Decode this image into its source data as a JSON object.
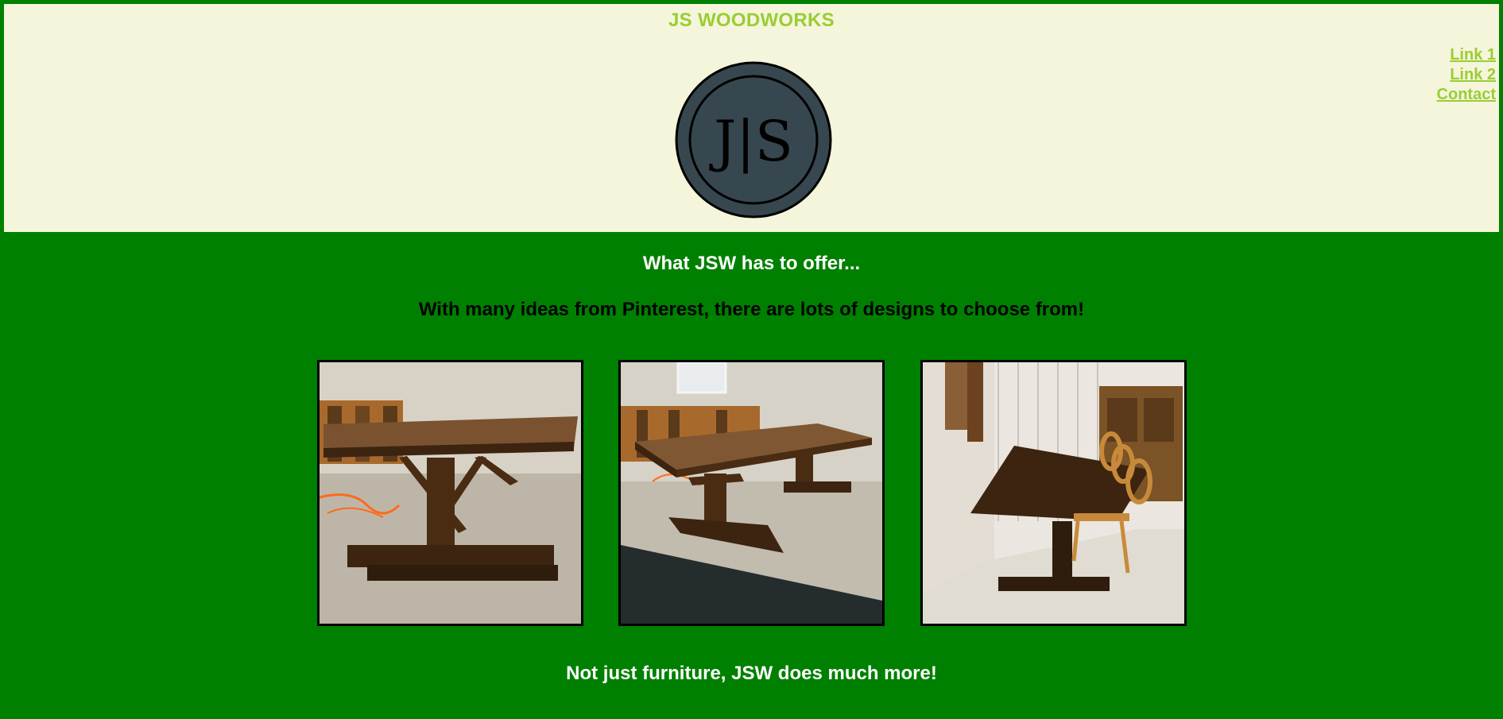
{
  "header": {
    "site_title": "JS WOODWORKS",
    "logo_text": "J|S",
    "nav": {
      "link1": "Link 1",
      "link2": "Link 2",
      "contact": "Contact"
    }
  },
  "main": {
    "offer_heading": "What JSW has to offer...",
    "offer_subtext": "With many ideas from Pinterest, there are lots of designs to choose from!",
    "more_heading": "Not just furniture, JSW does much more!"
  },
  "colors": {
    "page_background": "#008000",
    "header_background": "#f5f5dc",
    "title_and_links": "#9acd32",
    "logo_fill": "#37474f"
  }
}
